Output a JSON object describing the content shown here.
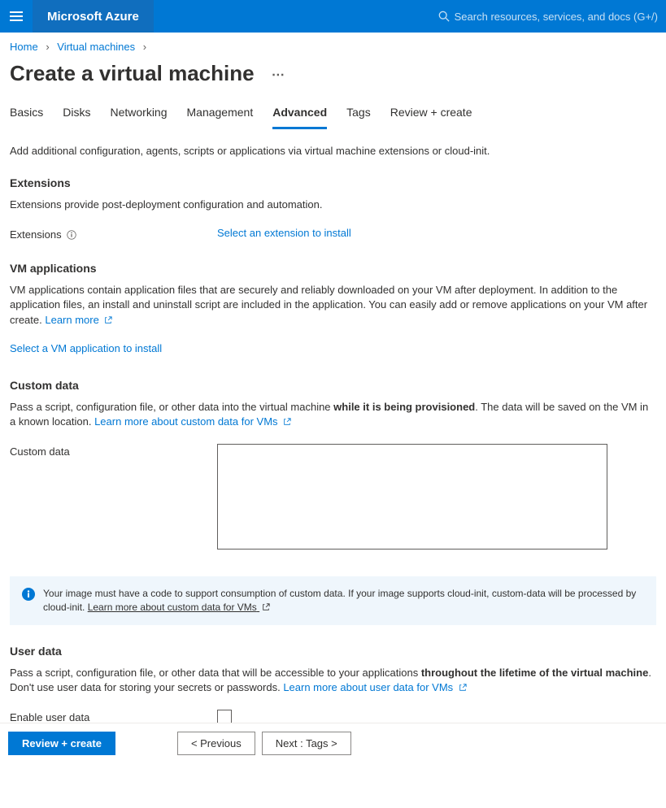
{
  "header": {
    "brand": "Microsoft Azure",
    "search_placeholder": "Search resources, services, and docs (G+/)"
  },
  "breadcrumb": {
    "items": [
      "Home",
      "Virtual machines"
    ]
  },
  "title": "Create a virtual machine",
  "tabs": [
    "Basics",
    "Disks",
    "Networking",
    "Management",
    "Advanced",
    "Tags",
    "Review + create"
  ],
  "active_tab": "Advanced",
  "intro": "Add additional configuration, agents, scripts or applications via virtual machine extensions or cloud-init.",
  "extensions": {
    "heading": "Extensions",
    "text": "Extensions provide post-deployment configuration and automation.",
    "field_label": "Extensions",
    "select_link": "Select an extension to install"
  },
  "vm_apps": {
    "heading": "VM applications",
    "text": "VM applications contain application files that are securely and reliably downloaded on your VM after deployment. In addition to the application files, an install and uninstall script are included in the application. You can easily add or remove applications on your VM after create. ",
    "learn_more": "Learn more",
    "select_link": "Select a VM application to install"
  },
  "custom_data": {
    "heading": "Custom data",
    "text_prefix": "Pass a script, configuration file, or other data into the virtual machine ",
    "text_bold": "while it is being provisioned",
    "text_suffix": ". The data will be saved on the VM in a known location. ",
    "learn_link": "Learn more about custom data for VMs",
    "field_label": "Custom data",
    "info_text": "Your image must have a code to support consumption of custom data. If your image supports cloud-init, custom-data will be processed by cloud-init. ",
    "info_link": "Learn more about custom data for VMs"
  },
  "user_data": {
    "heading": "User data",
    "text_prefix": "Pass a script, configuration file, or other data that will be accessible to your applications ",
    "text_bold": "throughout the lifetime of the virtual machine",
    "text_suffix": ". Don't use user data for storing your secrets or passwords. ",
    "learn_link": "Learn more about user data for VMs",
    "enable_label": "Enable user data"
  },
  "footer": {
    "review": "Review + create",
    "previous": "< Previous",
    "next": "Next : Tags >"
  }
}
